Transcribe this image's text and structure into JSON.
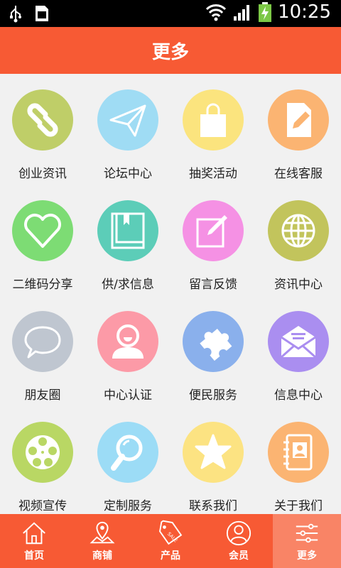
{
  "status_bar": {
    "time": "10:25"
  },
  "header": {
    "title": "更多"
  },
  "grid": [
    {
      "label": "创业资讯",
      "color": "#bfce68",
      "icon": "link-icon"
    },
    {
      "label": "论坛中心",
      "color": "#9fdcf4",
      "icon": "paper-plane-icon"
    },
    {
      "label": "抽奖活动",
      "color": "#fbe47e",
      "icon": "shopping-bag-icon"
    },
    {
      "label": "在线客服",
      "color": "#fbb472",
      "icon": "document-edit-icon"
    },
    {
      "label": "二维码分享",
      "color": "#7ddc74",
      "icon": "heart-icon"
    },
    {
      "label": "供/求信息",
      "color": "#5ccdb8",
      "icon": "book-icon"
    },
    {
      "label": "留言反馈",
      "color": "#f591e4",
      "icon": "pencil-square-icon"
    },
    {
      "label": "资讯中心",
      "color": "#c2c45c",
      "icon": "globe-icon"
    },
    {
      "label": "朋友圈",
      "color": "#bfc6d0",
      "icon": "speech-bubble-icon"
    },
    {
      "label": "中心认证",
      "color": "#fc9aa7",
      "icon": "user-icon"
    },
    {
      "label": "便民服务",
      "color": "#8ab0ec",
      "icon": "puzzle-icon"
    },
    {
      "label": "信息中心",
      "color": "#aa8ef0",
      "icon": "envelope-icon"
    },
    {
      "label": "视频宣传",
      "color": "#b9d764",
      "icon": "film-reel-icon"
    },
    {
      "label": "定制服务",
      "color": "#9cdcf6",
      "icon": "magnifier-icon"
    },
    {
      "label": "联系我们",
      "color": "#fce382",
      "icon": "star-icon"
    },
    {
      "label": "关于我们",
      "color": "#fbb472",
      "icon": "contact-book-icon"
    }
  ],
  "tabs": [
    {
      "label": "首页",
      "icon": "home-icon"
    },
    {
      "label": "商铺",
      "icon": "map-icon"
    },
    {
      "label": "产品",
      "icon": "sale-tag-icon"
    },
    {
      "label": "会员",
      "icon": "member-icon"
    },
    {
      "label": "更多",
      "icon": "settings-sliders-icon",
      "active": true
    }
  ]
}
